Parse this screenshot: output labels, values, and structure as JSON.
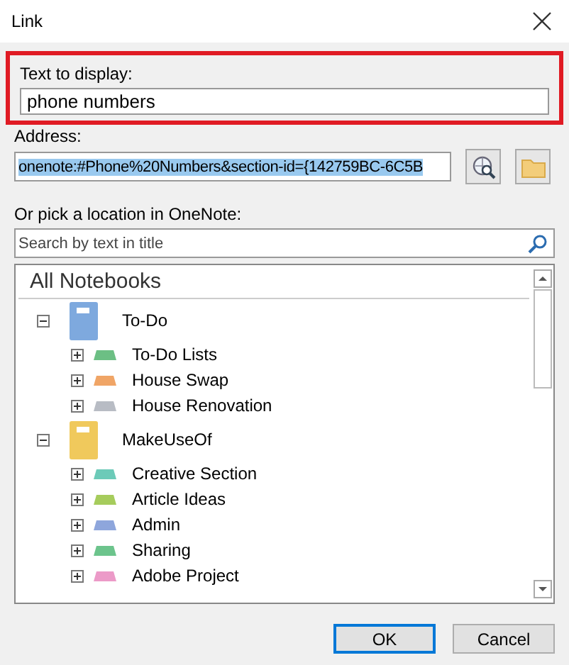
{
  "window": {
    "title": "Link"
  },
  "text_to_display": {
    "label": "Text to display:",
    "value": "phone numbers",
    "highlighted": true
  },
  "address": {
    "label": "Address:",
    "value": "onenote:#Phone%20Numbers&section-id={142759BC-6C5B",
    "selected": true
  },
  "pick_label": "Or pick a location in OneNote:",
  "search": {
    "placeholder": "Search by text in title"
  },
  "tree": {
    "heading": "All Notebooks",
    "items": [
      {
        "label": "To-Do",
        "kind": "notebook",
        "color": "#7ea9de",
        "expanded": true,
        "children": [
          {
            "label": "To-Do Lists",
            "kind": "section",
            "color": "#6cbf84",
            "expanded": false
          },
          {
            "label": "House Swap",
            "kind": "section",
            "color": "#f0a566",
            "expanded": false
          },
          {
            "label": "House Renovation",
            "kind": "section",
            "color": "#b8bcc4",
            "expanded": false
          }
        ]
      },
      {
        "label": "MakeUseOf",
        "kind": "notebook",
        "color": "#f0c95c",
        "expanded": true,
        "children": [
          {
            "label": "Creative Section",
            "kind": "section",
            "color": "#6ccab8",
            "expanded": false
          },
          {
            "label": "Article Ideas",
            "kind": "section",
            "color": "#a6cc5c",
            "expanded": false
          },
          {
            "label": "Admin",
            "kind": "section",
            "color": "#8ea6dc",
            "expanded": false
          },
          {
            "label": "Sharing",
            "kind": "section",
            "color": "#6cc48c",
            "expanded": false
          },
          {
            "label": "Adobe Project",
            "kind": "section",
            "color": "#ec9ac8",
            "expanded": false
          }
        ]
      }
    ]
  },
  "buttons": [
    {
      "label": "OK",
      "default": true
    },
    {
      "label": "Cancel",
      "default": false
    }
  ]
}
